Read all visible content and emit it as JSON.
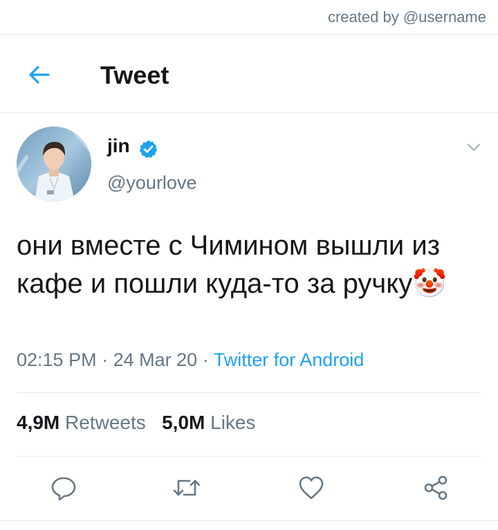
{
  "credit": "created by @username",
  "header": {
    "title": "Tweet",
    "back_icon": "arrow-left-icon"
  },
  "author": {
    "name": "jin",
    "handle": "@yourlove",
    "verified": true
  },
  "tweet": {
    "text": "они вместе с Чимином вышли из кафе и пошли куда-то за ручку🤡",
    "time": "02:15 PM",
    "separator": "·",
    "date": "24 Mar 20",
    "source": "Twitter for Android"
  },
  "stats": {
    "retweets_count": "4,9M",
    "retweets_label": "Retweets",
    "likes_count": "5,0M",
    "likes_label": "Likes"
  },
  "actions": [
    "reply-icon",
    "retweet-icon",
    "like-icon",
    "share-icon"
  ],
  "colors": {
    "accent": "#1da1f2",
    "secondary_text": "#657786",
    "divider": "#e1e8ed"
  }
}
